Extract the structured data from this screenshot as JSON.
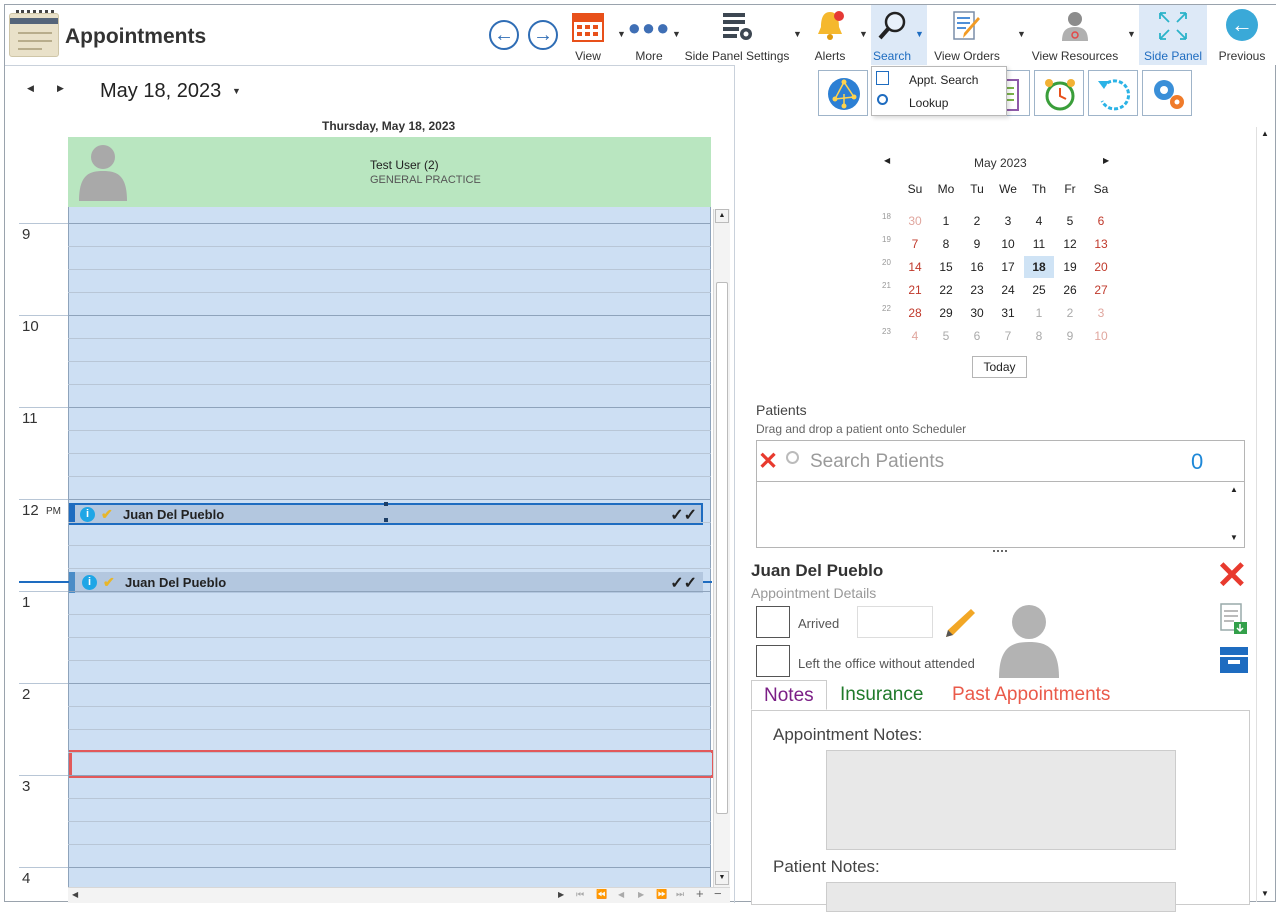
{
  "app": {
    "title": "Appointments"
  },
  "toolbar": {
    "view": "View",
    "more": "More",
    "side_panel_settings": "Side Panel Settings",
    "alerts": "Alerts",
    "search": "Search",
    "view_orders": "View Orders",
    "view_resources": "View Resources",
    "side_panel": "Side Panel",
    "previous": "Previous"
  },
  "search_menu": {
    "items": [
      "Appt. Search",
      "Lookup"
    ]
  },
  "scheduler": {
    "date": "May 18, 2023",
    "day_header": "Thursday, May 18, 2023",
    "resource_name": "Test User (2)",
    "resource_dept": "GENERAL PRACTICE",
    "hours": [
      "9",
      "10",
      "11",
      "12",
      "1",
      "2",
      "3",
      "4"
    ],
    "pm_label": "PM",
    "appointments": [
      {
        "name": "Juan Del Pueblo",
        "status": "✓✓"
      },
      {
        "name": "Juan Del Pueblo",
        "status": "✓✓"
      }
    ]
  },
  "mini_calendar": {
    "month": "May 2023",
    "weekdays": [
      "Su",
      "Mo",
      "Tu",
      "We",
      "Th",
      "Fr",
      "Sa"
    ],
    "weeks": [
      {
        "wk": "18",
        "days": [
          "30",
          "1",
          "2",
          "3",
          "4",
          "5",
          "6"
        ]
      },
      {
        "wk": "19",
        "days": [
          "7",
          "8",
          "9",
          "10",
          "11",
          "12",
          "13"
        ]
      },
      {
        "wk": "20",
        "days": [
          "14",
          "15",
          "16",
          "17",
          "18",
          "19",
          "20"
        ]
      },
      {
        "wk": "21",
        "days": [
          "21",
          "22",
          "23",
          "24",
          "25",
          "26",
          "27"
        ]
      },
      {
        "wk": "22",
        "days": [
          "28",
          "29",
          "30",
          "31",
          "1",
          "2",
          "3"
        ]
      },
      {
        "wk": "23",
        "days": [
          "4",
          "5",
          "6",
          "7",
          "8",
          "9",
          "10"
        ]
      }
    ],
    "selected": "18",
    "today_label": "Today"
  },
  "patients": {
    "title": "Patients",
    "hint": "Drag and drop a patient onto Scheduler",
    "search_placeholder": "Search Patients",
    "count": "0"
  },
  "details": {
    "patient_name": "Juan Del Pueblo",
    "subtitle": "Appointment Details",
    "arrived_label": "Arrived",
    "left_label": "Left the office without attended",
    "tabs": [
      "Notes",
      "Insurance",
      "Past Appointments"
    ],
    "appt_notes_label": "Appointment Notes:",
    "patient_notes_label": "Patient Notes:"
  },
  "colors": {
    "accent": "#1e88d8",
    "resource_header": "#b9e6c0",
    "day_bg": "#cddff3",
    "weekend": "#c0392b"
  }
}
